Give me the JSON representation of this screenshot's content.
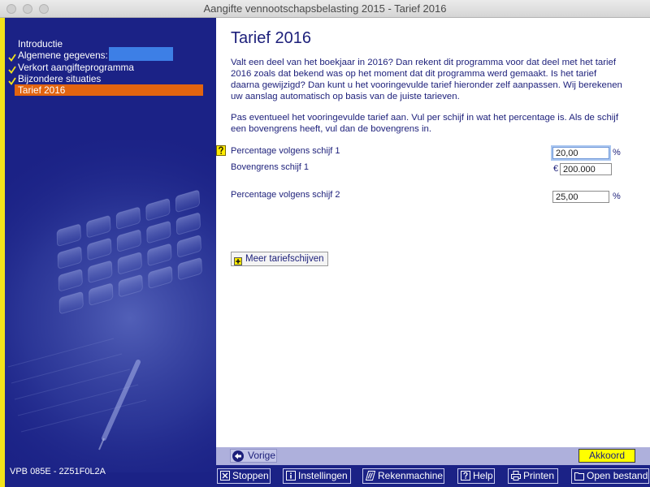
{
  "window": {
    "title": "Aangifte vennootschapsbelasting 2015 - Tarief 2016"
  },
  "colors": {
    "sidebar_bg": "#1b2286",
    "sidebar_stripe": "#f2e31b",
    "selected_item": "#e2640f",
    "check": "#f2e31b",
    "text_navy": "#1c1f7a",
    "nav_bar": "#aeb0dc",
    "accept_button": "#ffff00",
    "toolbar_bg": "#1b2286",
    "redaction": "#3d7fe6",
    "help_icon": "#ffec00"
  },
  "sidebar": {
    "items": [
      {
        "label": "Introductie",
        "checked": false,
        "selected": false
      },
      {
        "label": "Algemene gegevens:",
        "checked": true,
        "selected": false
      },
      {
        "label": "Verkort aangifteprogramma",
        "checked": true,
        "selected": false
      },
      {
        "label": "Bijzondere situaties",
        "checked": true,
        "selected": false
      },
      {
        "label": "Tarief 2016",
        "checked": false,
        "selected": true
      }
    ],
    "footer_code": "VPB 085E - 2Z51F0L2A"
  },
  "main": {
    "title": "Tarief 2016",
    "intro_lines": [
      "Valt een deel van het boekjaar in 2016? Dan rekent dit programma voor dat deel met het tarief",
      "2016 zoals dat bekend was op het moment dat dit programma werd gemaakt. Is het tarief",
      "daarna gewijzigd? Dan kunt u het vooringevulde tarief hieronder zelf aanpassen. Wij berekenen",
      "uw aanslag automatisch op basis van de juiste tarieven."
    ],
    "instruction_lines": [
      "Pas eventueel het vooringevulde tarief aan. Vul per schijf in wat het percentage is. Als de schijf",
      "een bovengrens heeft, vul dan de bovengrens in."
    ],
    "fields": [
      {
        "label": "Percentage volgens schijf 1",
        "value": "20,00",
        "unit": "%",
        "focused": true
      },
      {
        "label": "Bovengrens schijf 1",
        "value": "200.000",
        "currency": "€",
        "focused": false
      },
      {
        "label": "Percentage volgens schijf 2",
        "value": "25,00",
        "unit": "%",
        "focused": false
      }
    ],
    "more_button": {
      "label": "Meer tariefschijven",
      "icon": "plus-icon"
    }
  },
  "navigation": {
    "back_label": "Vorige",
    "back_icon": "back-arrow-icon",
    "accept_label": "Akkoord"
  },
  "toolbar": [
    {
      "label": "Stoppen",
      "icon": "close-box-icon"
    },
    {
      "label": "Instellingen",
      "icon": "info-box-icon"
    },
    {
      "label": "Rekenmachine",
      "icon": "calculator-icon"
    },
    {
      "label": "Help",
      "icon": "help-box-icon"
    },
    {
      "label": "Printen",
      "icon": "printer-icon"
    },
    {
      "label": "Open bestand",
      "icon": "folder-icon"
    }
  ]
}
